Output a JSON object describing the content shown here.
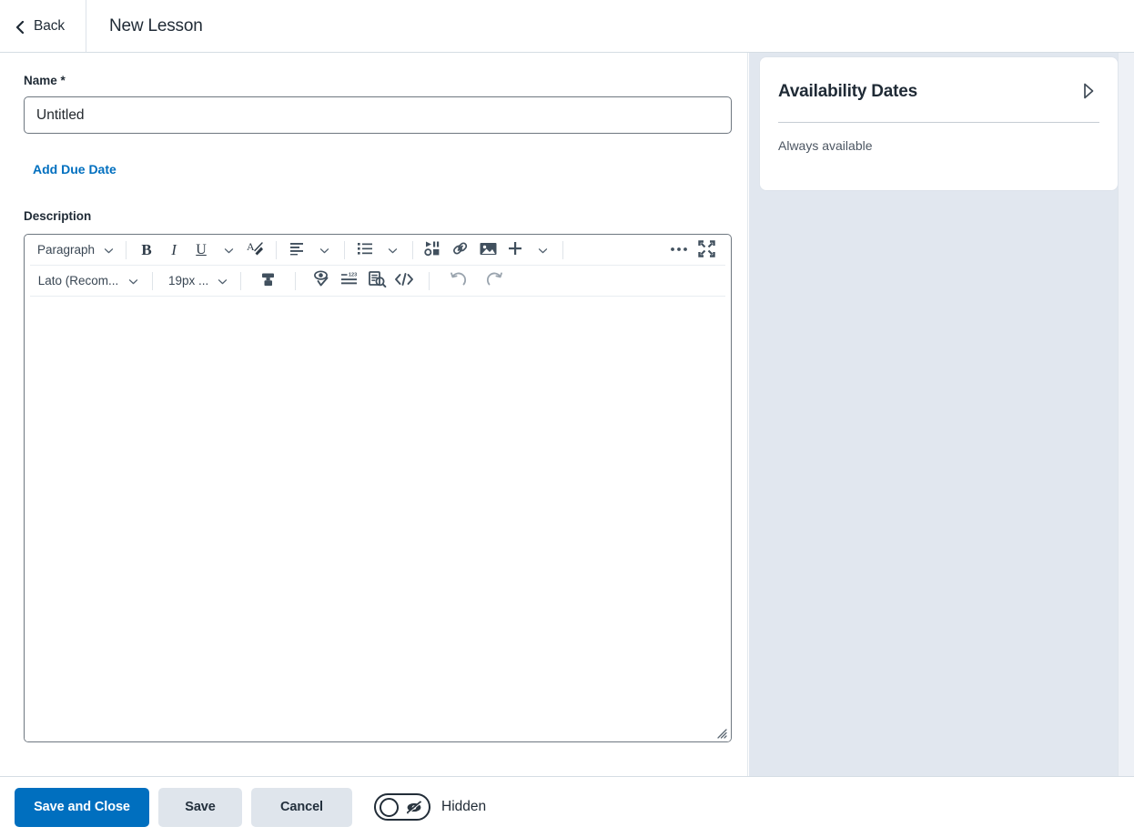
{
  "header": {
    "back_label": "Back",
    "back_icon": "chevron-left-icon",
    "title": "New Lesson"
  },
  "form": {
    "name_label": "Name",
    "name_required_marker": "*",
    "name_value": "Untitled",
    "name_placeholder": "Untitled",
    "add_due_date_label": "Add Due Date",
    "description_label": "Description"
  },
  "editor": {
    "row1": {
      "paragraph_style": "Paragraph",
      "bold": "B",
      "italic": "I",
      "underline": "U",
      "clear_formatting_icon": "clear-formatting-icon",
      "align_icon": "align-left-icon",
      "list_icon": "bulleted-list-icon",
      "insert_stuff_icon": "insert-stuff-icon",
      "link_icon": "quicklink-icon",
      "image_icon": "insert-image-icon",
      "plus_icon": "plus-icon",
      "more_icon": "more-options-icon",
      "fullscreen_icon": "fullscreen-icon"
    },
    "row2": {
      "font_family": "Lato (Recom...",
      "font_size": "19px ...",
      "highlight_icon": "highlight-color-icon",
      "accessibility_icon": "accessibility-checker-icon",
      "word_count_icon": "word-count-icon",
      "preview_icon": "preview-icon",
      "source_code_icon": "html-source-icon",
      "undo_icon": "undo-icon",
      "redo_icon": "redo-icon"
    },
    "content": "",
    "resize_handle": "resize-grip-icon"
  },
  "availability": {
    "title": "Availability Dates",
    "expand_icon": "expand-triangle-icon",
    "status": "Always available"
  },
  "footer": {
    "save_and_close_label": "Save and Close",
    "save_label": "Save",
    "cancel_label": "Cancel",
    "visibility_toggle_label": "Hidden",
    "visibility_toggle_icon": "eye-slash-icon",
    "visibility_toggle_state": "off"
  },
  "colors": {
    "accent_blue": "#006fbf",
    "link_blue": "#006fbf",
    "panel_bg": "#e1e7ef",
    "secondary_btn": "#dfe5ec",
    "text_primary": "#1f2a35",
    "border": "#6e7780"
  }
}
